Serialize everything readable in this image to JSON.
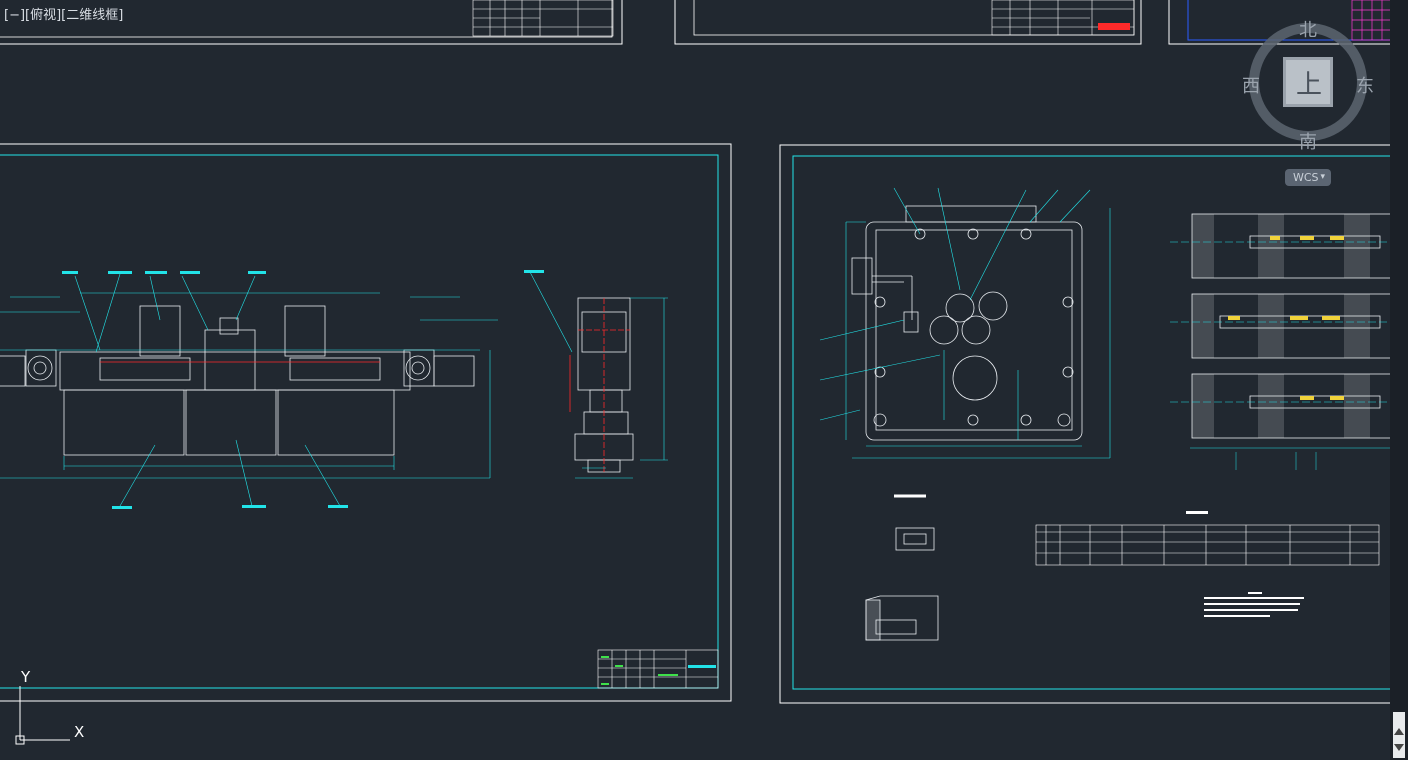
{
  "viewport": {
    "label": "[−][俯视][二维线框]"
  },
  "viewcube": {
    "north": "北",
    "south": "南",
    "east": "东",
    "west": "西",
    "face": "上",
    "wcs_label": "WCS",
    "wcs_chevron": "▾"
  },
  "ucs": {
    "x_label": "X",
    "y_label": "Y"
  },
  "colors": {
    "background": "#212830",
    "frame_white": "#ffffff",
    "frame_cyan": "#22e3e8",
    "geometry_white": "#e9edf1",
    "dim_green": "#3ee04a",
    "accent_red": "#ff2a2a",
    "accent_magenta": "#ff3bd5",
    "accent_blue": "#2a5bff"
  },
  "icons": [
    "viewcube-icon",
    "ucs-icon",
    "scroll-up-icon",
    "scroll-down-icon"
  ]
}
